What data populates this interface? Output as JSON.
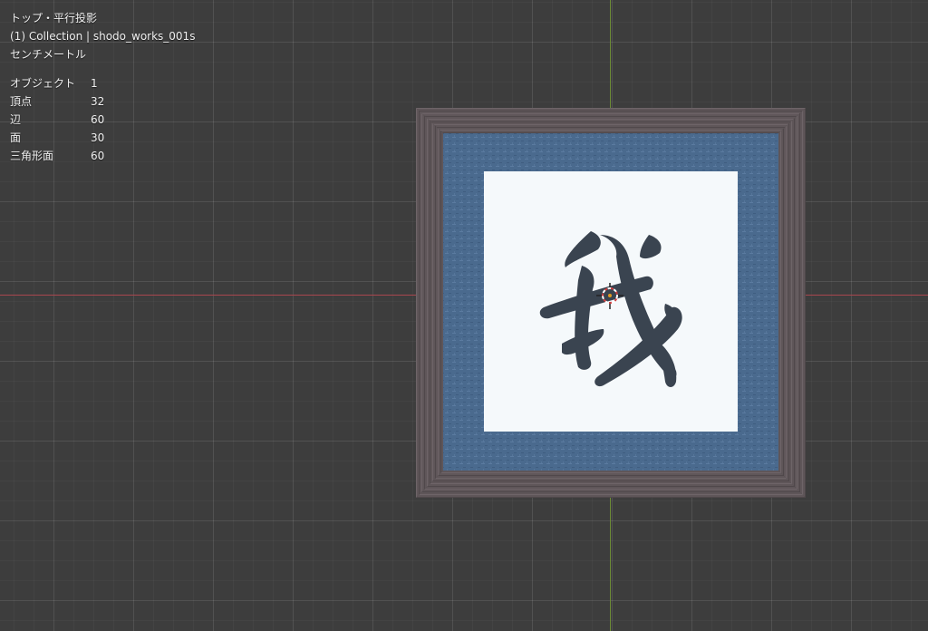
{
  "viewport": {
    "view_name": "トップ・平行投影",
    "collection_info": "(1) Collection | shodo_works_001s",
    "units": "センチメートル"
  },
  "stats": [
    {
      "label": "オブジェクト",
      "value": "1"
    },
    {
      "label": "頂点",
      "value": "32"
    },
    {
      "label": "辺",
      "value": "60"
    },
    {
      "label": "面",
      "value": "30"
    },
    {
      "label": "三角形面",
      "value": "60"
    }
  ],
  "colors": {
    "background": "#3d3d3d",
    "axis_x": "#a8464e",
    "axis_y": "#6d8c35",
    "frame_wood": "#5f5659",
    "mat_blue": "#4a6a8e",
    "paper": "#f5f9fb",
    "ink": "#3a4450"
  },
  "icons": {
    "origin": "3d-cursor-icon"
  }
}
